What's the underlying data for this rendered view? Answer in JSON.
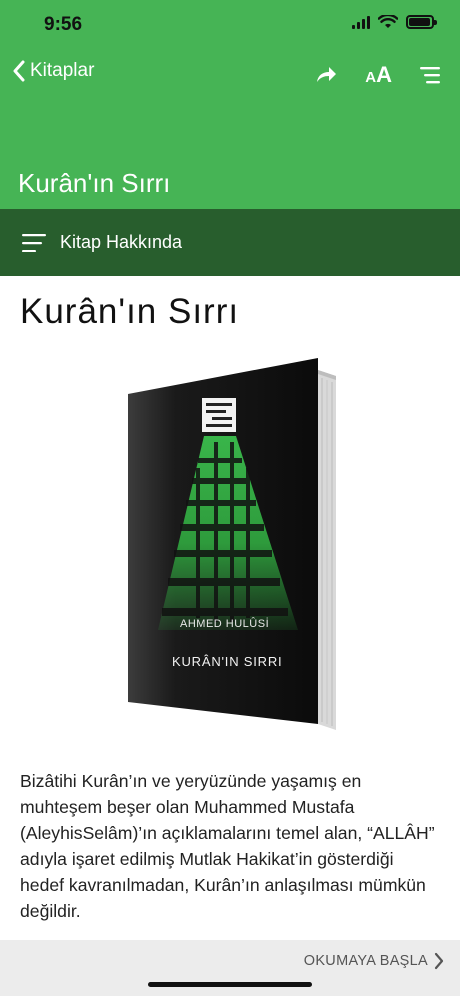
{
  "status_bar": {
    "time": "9:56"
  },
  "nav": {
    "back_label": "Kitaplar",
    "title": "Kurân'ın Sırrı",
    "font_size_small": "A",
    "font_size_large": "A"
  },
  "section": {
    "label": "Kitap Hakkında"
  },
  "book": {
    "title": "Kurân'ın Sırrı",
    "cover": {
      "author": "AHMED HULÛSİ",
      "title": "KURÂN'IN SIRRI"
    },
    "description": "Bizâtihi Kurân’ın ve yeryüzünde yaşamış en muhteşem beşer olan Muhammed Mustafa (AleyhisSelâm)’ın açıklamalarını temel alan, “ALLÂH” adıyla işaret edilmiş Mutlak Hakikat’in gösterdiği hedef kavranılmadan, Kurân’ın anlaşılması mümkün değildir."
  },
  "bottom": {
    "start_reading_label": "OKUMAYA BAŞLA"
  },
  "colors": {
    "header_green": "#46b455",
    "section_green": "#285e2d",
    "bottom_gray": "#ececec"
  },
  "icons": {
    "back": "chevron-left-icon",
    "share": "share-icon",
    "font_size": "font-size-icon",
    "toc": "table-of-contents-icon",
    "menu": "hamburger-menu-icon",
    "next": "chevron-right-icon"
  }
}
